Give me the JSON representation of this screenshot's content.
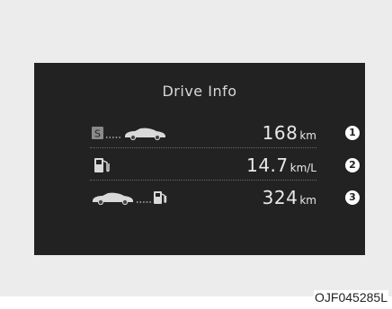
{
  "panel": {
    "title": "Drive Info"
  },
  "rows": [
    {
      "icon_left": "start-badge-icon",
      "start_badge": "S",
      "icon_right": "car-icon",
      "value": "168",
      "unit": "km",
      "badge": "1"
    },
    {
      "icon_left": "fuel-pump-icon",
      "value": "14.7",
      "unit": "km/L",
      "badge": "2"
    },
    {
      "icon_left": "car-icon",
      "icon_right": "fuel-pump-icon",
      "value": "324",
      "unit": "km",
      "badge": "3"
    }
  ],
  "figure_code": "OJF045285L",
  "colors": {
    "panel_bg": "#222222",
    "frame_bg": "#ececed",
    "text": "#e8e8e8"
  }
}
